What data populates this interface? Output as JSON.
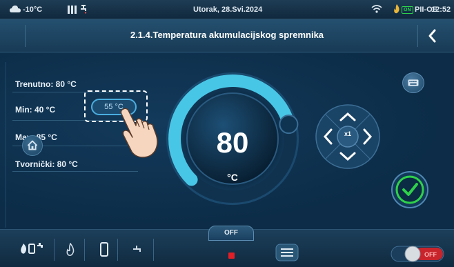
{
  "status": {
    "outdoor_temp": "-10°C",
    "date": "Utorak, 28.Svi.2024",
    "on_badge": "ON",
    "mode": "PII-OE",
    "time": "12:52"
  },
  "header": {
    "title": "2.1.4.Temperatura akumulacijskog spremnika"
  },
  "params": {
    "current": "Trenutno: 80 °C",
    "min": "Min: 40 °C",
    "max": "Max: 85 °C",
    "factory": "Tvornički: 80 °C"
  },
  "min_pill": "55 °C",
  "dial": {
    "value": "80",
    "unit": "°C",
    "level": 0.78
  },
  "dpad": {
    "step": "x1"
  },
  "bottom": {
    "off_label": "OFF",
    "toggle_label": "OFF"
  },
  "colors": {
    "accent": "#48c6e6",
    "ok_green": "#2fd14a",
    "alarm_red": "#e01f27"
  }
}
